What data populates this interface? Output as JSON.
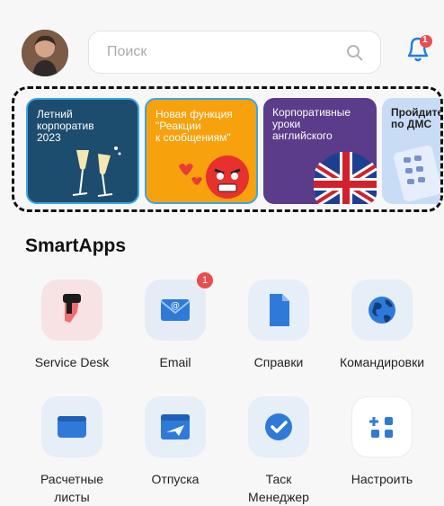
{
  "header": {
    "search_placeholder": "Поиск",
    "bell_badge": "1",
    "avatar": "user-avatar"
  },
  "stories": [
    {
      "title": "Летний\nкорпоратив\n2023"
    },
    {
      "title": "Новая функция\n\"Реакции\nк сообщениям\""
    },
    {
      "title": "Корпоративные\nуроки\nанглийского"
    },
    {
      "title": "Пройдите\nпо ДМС"
    }
  ],
  "smartapps": {
    "title": "SmartApps",
    "apps": [
      {
        "label": "Service Desk",
        "icon": "service-desk-icon",
        "badge": ""
      },
      {
        "label": "Email",
        "icon": "email-icon",
        "badge": "1"
      },
      {
        "label": "Справки",
        "icon": "document-icon",
        "badge": ""
      },
      {
        "label": "Командировки",
        "icon": "globe-icon",
        "badge": ""
      },
      {
        "label": "Расчетные\nлисты",
        "icon": "wallet-icon",
        "badge": ""
      },
      {
        "label": "Отпуска",
        "icon": "calendar-plane-icon",
        "badge": ""
      },
      {
        "label": "Таск\nМенеджер",
        "icon": "task-check-icon",
        "badge": ""
      },
      {
        "label": "Настроить",
        "icon": "add-apps-icon",
        "badge": ""
      }
    ]
  },
  "colors": {
    "accent": "#1f7de2",
    "badge": "#e94e4e"
  }
}
